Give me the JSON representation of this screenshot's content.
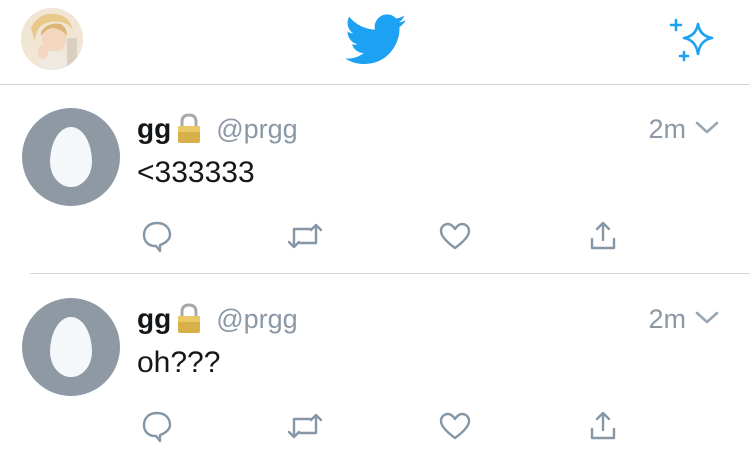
{
  "header": {
    "icons": {
      "avatar": "user-avatar-photo",
      "logo": "twitter-bird-icon",
      "sparkle": "sparkle-icon"
    },
    "colors": {
      "brand": "#1da1f2",
      "divider": "#cfd6dc"
    }
  },
  "tweets": [
    {
      "display_name": "gg",
      "protected_icon": "lock-icon",
      "handle": "@prgg",
      "time": "2m",
      "text": "<333333",
      "actions": [
        "reply-icon",
        "retweet-icon",
        "like-icon",
        "share-icon"
      ]
    },
    {
      "display_name": "gg",
      "protected_icon": "lock-icon",
      "handle": "@prgg",
      "time": "2m",
      "text": "oh???",
      "actions": [
        "reply-icon",
        "retweet-icon",
        "like-icon",
        "share-icon"
      ]
    }
  ],
  "colors": {
    "text_primary": "#14171a",
    "text_secondary": "#8b98a5",
    "icon_gray": "#8596a6",
    "egg_bg": "#8e99a4"
  }
}
